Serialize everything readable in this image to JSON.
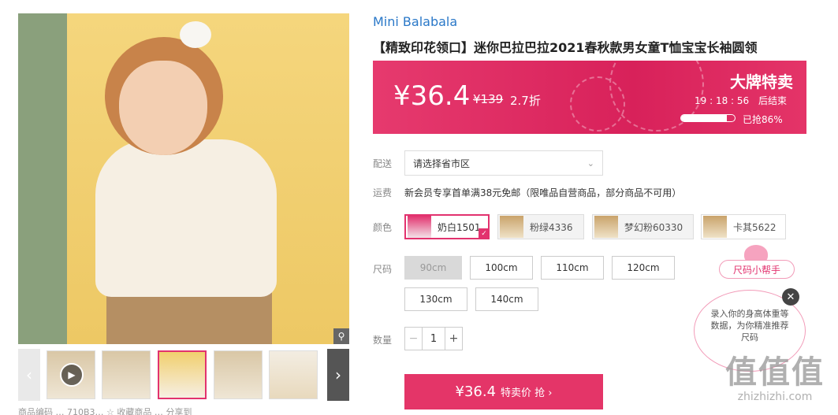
{
  "gallery": {
    "zoom_icon": "magnifier-icon",
    "thumbs": [
      "video",
      "img2",
      "img3",
      "img4",
      "img5"
    ]
  },
  "bottom_bar": {
    "text": "商品编码 … 710B3… ☆ 收藏商品 … 分享到"
  },
  "product": {
    "brand": "Mini Balabala",
    "title": "【精致印花领口】迷你巴拉巴拉2021春秋款男女童T恤宝宝长袖圆领"
  },
  "price_banner": {
    "price": "¥36.4",
    "original_price": "¥139",
    "discount": "2.7折",
    "event": "大牌特卖",
    "countdown": "19 : 18 : 56",
    "countdown_suffix": "后结束",
    "progress_percent": 86,
    "progress_text": "已抢86%",
    "accent": "#e2326e"
  },
  "shipping": {
    "label": "配送",
    "region_placeholder": "请选择省市区",
    "fee_label": "运费",
    "fee_text": "新会员专享首单满38元免邮（限唯品自营商品，部分商品不可用）"
  },
  "colors": {
    "label": "颜色",
    "options": [
      "奶白1501",
      "粉绿4336",
      "梦幻粉60330",
      "卡其5622"
    ],
    "selected": "奶白1501"
  },
  "sizes": {
    "label": "尺码",
    "options": [
      "90cm",
      "100cm",
      "110cm",
      "120cm",
      "130cm",
      "140cm"
    ],
    "disabled": [
      "90cm"
    ]
  },
  "size_helper": {
    "label": "尺码小帮手",
    "bubble": "录入你的身高体重等数据，为你精准推荐尺码"
  },
  "quantity": {
    "label": "数量",
    "minus": "−",
    "value": "1",
    "plus": "+"
  },
  "buy": {
    "price": "¥36.4",
    "label": "特卖价 抢 ›"
  },
  "watermark": {
    "logo": "值值值",
    "url": "zhizhizhi.com"
  }
}
